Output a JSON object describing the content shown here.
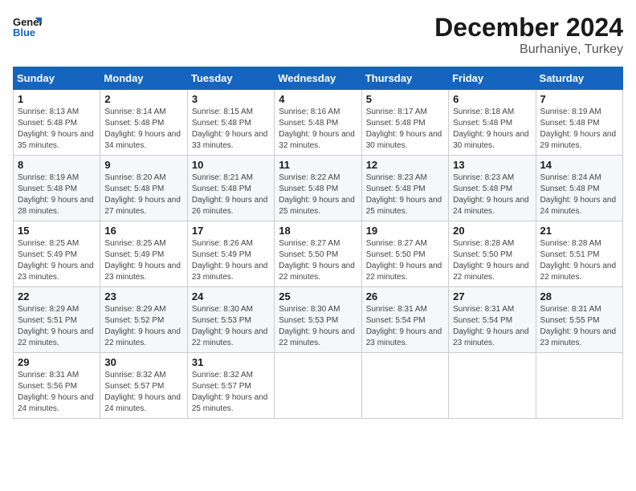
{
  "header": {
    "logo_line1": "General",
    "logo_line2": "Blue",
    "month": "December 2024",
    "location": "Burhaniye, Turkey"
  },
  "days_of_week": [
    "Sunday",
    "Monday",
    "Tuesday",
    "Wednesday",
    "Thursday",
    "Friday",
    "Saturday"
  ],
  "weeks": [
    [
      {
        "day": "1",
        "sunrise": "Sunrise: 8:13 AM",
        "sunset": "Sunset: 5:48 PM",
        "daylight": "Daylight: 9 hours and 35 minutes."
      },
      {
        "day": "2",
        "sunrise": "Sunrise: 8:14 AM",
        "sunset": "Sunset: 5:48 PM",
        "daylight": "Daylight: 9 hours and 34 minutes."
      },
      {
        "day": "3",
        "sunrise": "Sunrise: 8:15 AM",
        "sunset": "Sunset: 5:48 PM",
        "daylight": "Daylight: 9 hours and 33 minutes."
      },
      {
        "day": "4",
        "sunrise": "Sunrise: 8:16 AM",
        "sunset": "Sunset: 5:48 PM",
        "daylight": "Daylight: 9 hours and 32 minutes."
      },
      {
        "day": "5",
        "sunrise": "Sunrise: 8:17 AM",
        "sunset": "Sunset: 5:48 PM",
        "daylight": "Daylight: 9 hours and 30 minutes."
      },
      {
        "day": "6",
        "sunrise": "Sunrise: 8:18 AM",
        "sunset": "Sunset: 5:48 PM",
        "daylight": "Daylight: 9 hours and 30 minutes."
      },
      {
        "day": "7",
        "sunrise": "Sunrise: 8:19 AM",
        "sunset": "Sunset: 5:48 PM",
        "daylight": "Daylight: 9 hours and 29 minutes."
      }
    ],
    [
      {
        "day": "8",
        "sunrise": "Sunrise: 8:19 AM",
        "sunset": "Sunset: 5:48 PM",
        "daylight": "Daylight: 9 hours and 28 minutes."
      },
      {
        "day": "9",
        "sunrise": "Sunrise: 8:20 AM",
        "sunset": "Sunset: 5:48 PM",
        "daylight": "Daylight: 9 hours and 27 minutes."
      },
      {
        "day": "10",
        "sunrise": "Sunrise: 8:21 AM",
        "sunset": "Sunset: 5:48 PM",
        "daylight": "Daylight: 9 hours and 26 minutes."
      },
      {
        "day": "11",
        "sunrise": "Sunrise: 8:22 AM",
        "sunset": "Sunset: 5:48 PM",
        "daylight": "Daylight: 9 hours and 25 minutes."
      },
      {
        "day": "12",
        "sunrise": "Sunrise: 8:23 AM",
        "sunset": "Sunset: 5:48 PM",
        "daylight": "Daylight: 9 hours and 25 minutes."
      },
      {
        "day": "13",
        "sunrise": "Sunrise: 8:23 AM",
        "sunset": "Sunset: 5:48 PM",
        "daylight": "Daylight: 9 hours and 24 minutes."
      },
      {
        "day": "14",
        "sunrise": "Sunrise: 8:24 AM",
        "sunset": "Sunset: 5:48 PM",
        "daylight": "Daylight: 9 hours and 24 minutes."
      }
    ],
    [
      {
        "day": "15",
        "sunrise": "Sunrise: 8:25 AM",
        "sunset": "Sunset: 5:49 PM",
        "daylight": "Daylight: 9 hours and 23 minutes."
      },
      {
        "day": "16",
        "sunrise": "Sunrise: 8:25 AM",
        "sunset": "Sunset: 5:49 PM",
        "daylight": "Daylight: 9 hours and 23 minutes."
      },
      {
        "day": "17",
        "sunrise": "Sunrise: 8:26 AM",
        "sunset": "Sunset: 5:49 PM",
        "daylight": "Daylight: 9 hours and 23 minutes."
      },
      {
        "day": "18",
        "sunrise": "Sunrise: 8:27 AM",
        "sunset": "Sunset: 5:50 PM",
        "daylight": "Daylight: 9 hours and 22 minutes."
      },
      {
        "day": "19",
        "sunrise": "Sunrise: 8:27 AM",
        "sunset": "Sunset: 5:50 PM",
        "daylight": "Daylight: 9 hours and 22 minutes."
      },
      {
        "day": "20",
        "sunrise": "Sunrise: 8:28 AM",
        "sunset": "Sunset: 5:50 PM",
        "daylight": "Daylight: 9 hours and 22 minutes."
      },
      {
        "day": "21",
        "sunrise": "Sunrise: 8:28 AM",
        "sunset": "Sunset: 5:51 PM",
        "daylight": "Daylight: 9 hours and 22 minutes."
      }
    ],
    [
      {
        "day": "22",
        "sunrise": "Sunrise: 8:29 AM",
        "sunset": "Sunset: 5:51 PM",
        "daylight": "Daylight: 9 hours and 22 minutes."
      },
      {
        "day": "23",
        "sunrise": "Sunrise: 8:29 AM",
        "sunset": "Sunset: 5:52 PM",
        "daylight": "Daylight: 9 hours and 22 minutes."
      },
      {
        "day": "24",
        "sunrise": "Sunrise: 8:30 AM",
        "sunset": "Sunset: 5:53 PM",
        "daylight": "Daylight: 9 hours and 22 minutes."
      },
      {
        "day": "25",
        "sunrise": "Sunrise: 8:30 AM",
        "sunset": "Sunset: 5:53 PM",
        "daylight": "Daylight: 9 hours and 22 minutes."
      },
      {
        "day": "26",
        "sunrise": "Sunrise: 8:31 AM",
        "sunset": "Sunset: 5:54 PM",
        "daylight": "Daylight: 9 hours and 23 minutes."
      },
      {
        "day": "27",
        "sunrise": "Sunrise: 8:31 AM",
        "sunset": "Sunset: 5:54 PM",
        "daylight": "Daylight: 9 hours and 23 minutes."
      },
      {
        "day": "28",
        "sunrise": "Sunrise: 8:31 AM",
        "sunset": "Sunset: 5:55 PM",
        "daylight": "Daylight: 9 hours and 23 minutes."
      }
    ],
    [
      {
        "day": "29",
        "sunrise": "Sunrise: 8:31 AM",
        "sunset": "Sunset: 5:56 PM",
        "daylight": "Daylight: 9 hours and 24 minutes."
      },
      {
        "day": "30",
        "sunrise": "Sunrise: 8:32 AM",
        "sunset": "Sunset: 5:57 PM",
        "daylight": "Daylight: 9 hours and 24 minutes."
      },
      {
        "day": "31",
        "sunrise": "Sunrise: 8:32 AM",
        "sunset": "Sunset: 5:57 PM",
        "daylight": "Daylight: 9 hours and 25 minutes."
      },
      null,
      null,
      null,
      null
    ]
  ]
}
